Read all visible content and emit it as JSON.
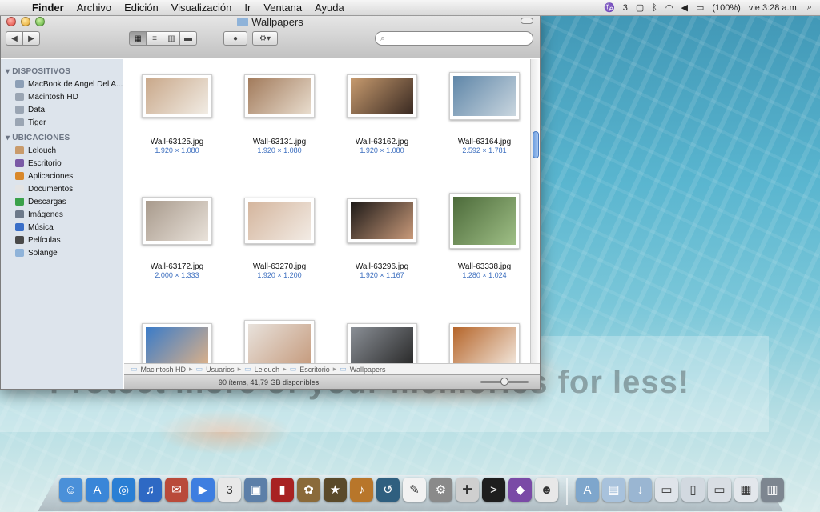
{
  "menubar": {
    "app_name": "Finder",
    "menus": [
      "Archivo",
      "Edición",
      "Visualización",
      "Ir",
      "Ventana",
      "Ayuda"
    ],
    "status": {
      "adobe_count": "3",
      "battery": "(100%)",
      "clock": "vie 3:28 a.m."
    }
  },
  "window": {
    "title": "Wallpapers",
    "search_placeholder": ""
  },
  "sidebar": {
    "sections": [
      {
        "title": "DISPOSITIVOS",
        "items": [
          {
            "label": "MacBook de Angel Del A...",
            "icon": "laptop-icon",
            "color": "#8c9fb6"
          },
          {
            "label": "Macintosh HD",
            "icon": "hard-drive-icon",
            "color": "#9aa5b3"
          },
          {
            "label": "Data",
            "icon": "hard-drive-icon",
            "color": "#9aa5b3"
          },
          {
            "label": "Tiger",
            "icon": "hard-drive-icon",
            "color": "#9aa5b3"
          }
        ]
      },
      {
        "title": "UBICACIONES",
        "items": [
          {
            "label": "Lelouch",
            "icon": "home-icon",
            "color": "#c99b6b"
          },
          {
            "label": "Escritorio",
            "icon": "desktop-icon",
            "color": "#7a5aa6"
          },
          {
            "label": "Aplicaciones",
            "icon": "applications-icon",
            "color": "#d9882a"
          },
          {
            "label": "Documentos",
            "icon": "documents-icon",
            "color": "#e4e4e4"
          },
          {
            "label": "Descargas",
            "icon": "downloads-icon",
            "color": "#3aa14a"
          },
          {
            "label": "Imágenes",
            "icon": "pictures-icon",
            "color": "#6d7a8a"
          },
          {
            "label": "Música",
            "icon": "music-icon",
            "color": "#3a6fc8"
          },
          {
            "label": "Películas",
            "icon": "movies-icon",
            "color": "#4a4a4a"
          },
          {
            "label": "Solange",
            "icon": "folder-icon",
            "color": "#8fb3d9"
          }
        ]
      }
    ]
  },
  "files": [
    {
      "name": "Wall-63125.jpg",
      "dims": "1.920 × 1.080",
      "colors": [
        "#c9a88a",
        "#f1ece4"
      ]
    },
    {
      "name": "Wall-63131.jpg",
      "dims": "1.920 × 1.080",
      "colors": [
        "#a27b5c",
        "#e8dccd"
      ]
    },
    {
      "name": "Wall-63162.jpg",
      "dims": "1.920 × 1.080",
      "colors": [
        "#c69a6e",
        "#3a2a22"
      ]
    },
    {
      "name": "Wall-63164.jpg",
      "dims": "2.592 × 1.781",
      "colors": [
        "#5f86a8",
        "#c9d6df"
      ]
    },
    {
      "name": "Wall-63172.jpg",
      "dims": "2.000 × 1.333",
      "colors": [
        "#a89a8c",
        "#e9e2da"
      ]
    },
    {
      "name": "Wall-63270.jpg",
      "dims": "1.920 × 1.200",
      "colors": [
        "#d4b59d",
        "#f2ebe4"
      ]
    },
    {
      "name": "Wall-63296.jpg",
      "dims": "1.920 × 1.167",
      "colors": [
        "#1e1a18",
        "#c99a7a"
      ]
    },
    {
      "name": "Wall-63338.jpg",
      "dims": "1.280 × 1.024",
      "colors": [
        "#4c6a3a",
        "#9fbf86"
      ]
    },
    {
      "name": "",
      "dims": "",
      "colors": [
        "#3a7bc8",
        "#d9b08a"
      ]
    },
    {
      "name": "",
      "dims": "",
      "colors": [
        "#e8e2dc",
        "#c59a7c"
      ]
    },
    {
      "name": "",
      "dims": "",
      "colors": [
        "#8a8f96",
        "#2a2a2a"
      ]
    },
    {
      "name": "",
      "dims": "",
      "colors": [
        "#b5652a",
        "#f1e4d8"
      ]
    }
  ],
  "pathbar": [
    "Macintosh HD",
    "Usuarios",
    "Lelouch",
    "Escritorio",
    "Wallpapers"
  ],
  "status_text": "90 ítems, 41,79 GB disponibles",
  "zoom_level": 0.5,
  "watermark": "Protect more of your memories for less!",
  "dock": [
    {
      "name": "finder",
      "color": "#4a90d9",
      "glyph": "☺"
    },
    {
      "name": "app-store",
      "color": "#3a86d8",
      "glyph": "A"
    },
    {
      "name": "safari",
      "color": "#2a7fd4",
      "glyph": "◎"
    },
    {
      "name": "itunes",
      "color": "#2e69c4",
      "glyph": "♫"
    },
    {
      "name": "mail",
      "color": "#b94a3a",
      "glyph": "✉"
    },
    {
      "name": "facetime",
      "color": "#3e7ee0",
      "glyph": "▶"
    },
    {
      "name": "ical",
      "color": "#e8e8e8",
      "glyph": "3"
    },
    {
      "name": "preview",
      "color": "#5c7fa8",
      "glyph": "▣"
    },
    {
      "name": "photo-booth",
      "color": "#a82222",
      "glyph": "▮"
    },
    {
      "name": "iphoto",
      "color": "#8a6a3a",
      "glyph": "✿"
    },
    {
      "name": "imovie",
      "color": "#5a4a2a",
      "glyph": "★"
    },
    {
      "name": "garageband",
      "color": "#b8762a",
      "glyph": "♪"
    },
    {
      "name": "time-machine",
      "color": "#2f5f7f",
      "glyph": "↺"
    },
    {
      "name": "textedit",
      "color": "#f2f2f2",
      "glyph": "✎"
    },
    {
      "name": "system-preferences",
      "color": "#8a8a8a",
      "glyph": "⚙"
    },
    {
      "name": "utility",
      "color": "#cfcfcf",
      "glyph": "✚"
    },
    {
      "name": "terminal",
      "color": "#1e1e1e",
      "glyph": ">"
    },
    {
      "name": "photo-app",
      "color": "#7a4aa6",
      "glyph": "◆"
    },
    {
      "name": "messages",
      "color": "#e8e8e8",
      "glyph": "☻"
    },
    {
      "name": "applications-stack",
      "color": "#7ea6cc",
      "glyph": "A"
    },
    {
      "name": "documents-stack",
      "color": "#a8c2dc",
      "glyph": "▤"
    },
    {
      "name": "downloads-stack",
      "color": "#9ab6d2",
      "glyph": "↓"
    },
    {
      "name": "stack-1",
      "color": "#dfe4ea",
      "glyph": "▭"
    },
    {
      "name": "stack-2",
      "color": "#d2d9e0",
      "glyph": "▯"
    },
    {
      "name": "stack-3",
      "color": "#d9dee4",
      "glyph": "▭"
    },
    {
      "name": "stack-4",
      "color": "#e3e7ec",
      "glyph": "▦"
    },
    {
      "name": "trash",
      "color": "#7d8690",
      "glyph": "▥"
    }
  ]
}
